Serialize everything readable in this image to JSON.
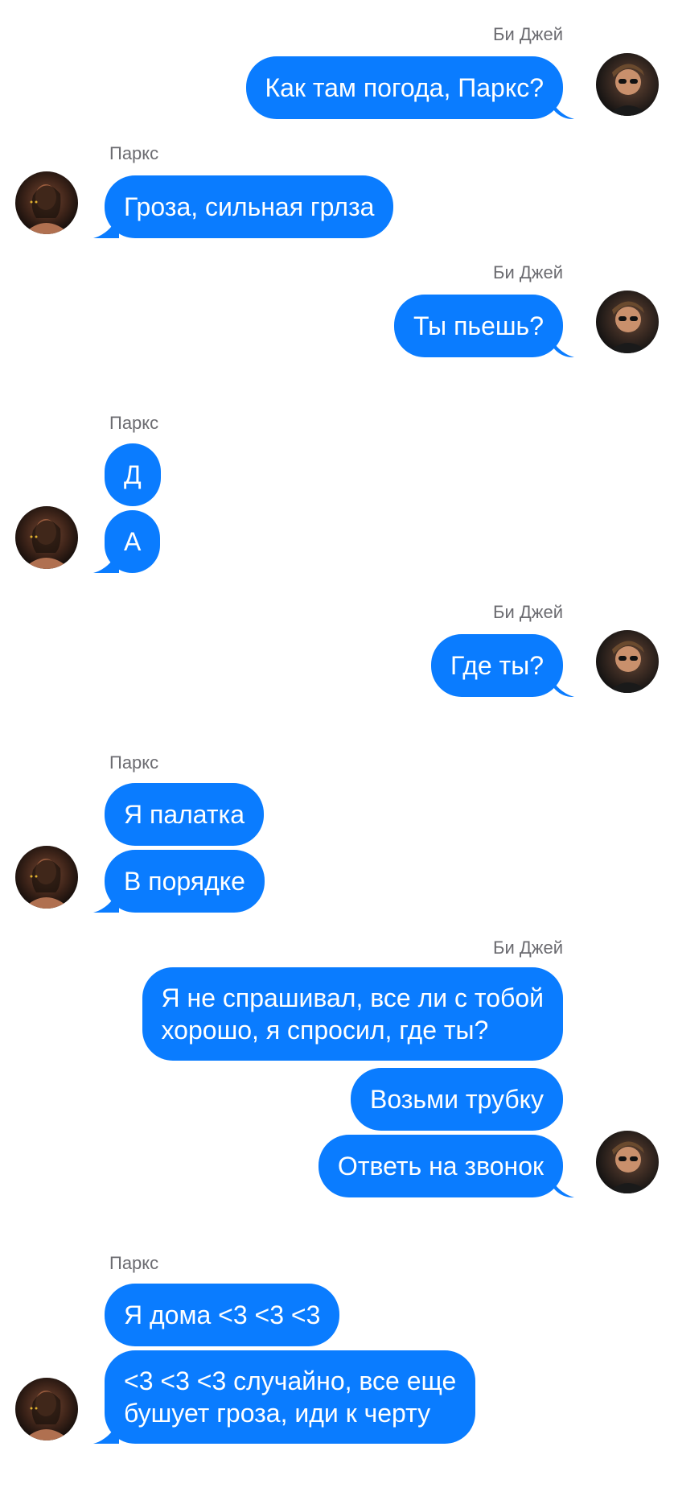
{
  "senders": {
    "bj": "Би Джей",
    "pk": "Паркс"
  },
  "messages": [
    {
      "text": "Как там погода, Паркс?"
    },
    {
      "text": "Гроза, сильная грлза"
    },
    {
      "text": "Ты пьешь?"
    },
    {
      "text": "Д"
    },
    {
      "text": "А"
    },
    {
      "text": "Где ты?"
    },
    {
      "text": "Я палатка"
    },
    {
      "text": "В порядке"
    },
    {
      "line1": "Я не спрашивал, все ли с тобой",
      "line2": "хорошо, я спросил, где ты?"
    },
    {
      "text": "Возьми трубку"
    },
    {
      "text": "Ответь на звонок"
    },
    {
      "text": "Я дома <3 <3 <3"
    },
    {
      "line1": "<3 <3 <3 случайно, все еще",
      "line2": "бушует гроза, иди к черту"
    }
  ],
  "colors": {
    "bubble": "#0a7cff",
    "name": "#6b6b70",
    "background": "#ffffff"
  },
  "icons": {
    "bj_avatar": "avatar-bj-icon",
    "pk_avatar": "avatar-parks-icon"
  }
}
